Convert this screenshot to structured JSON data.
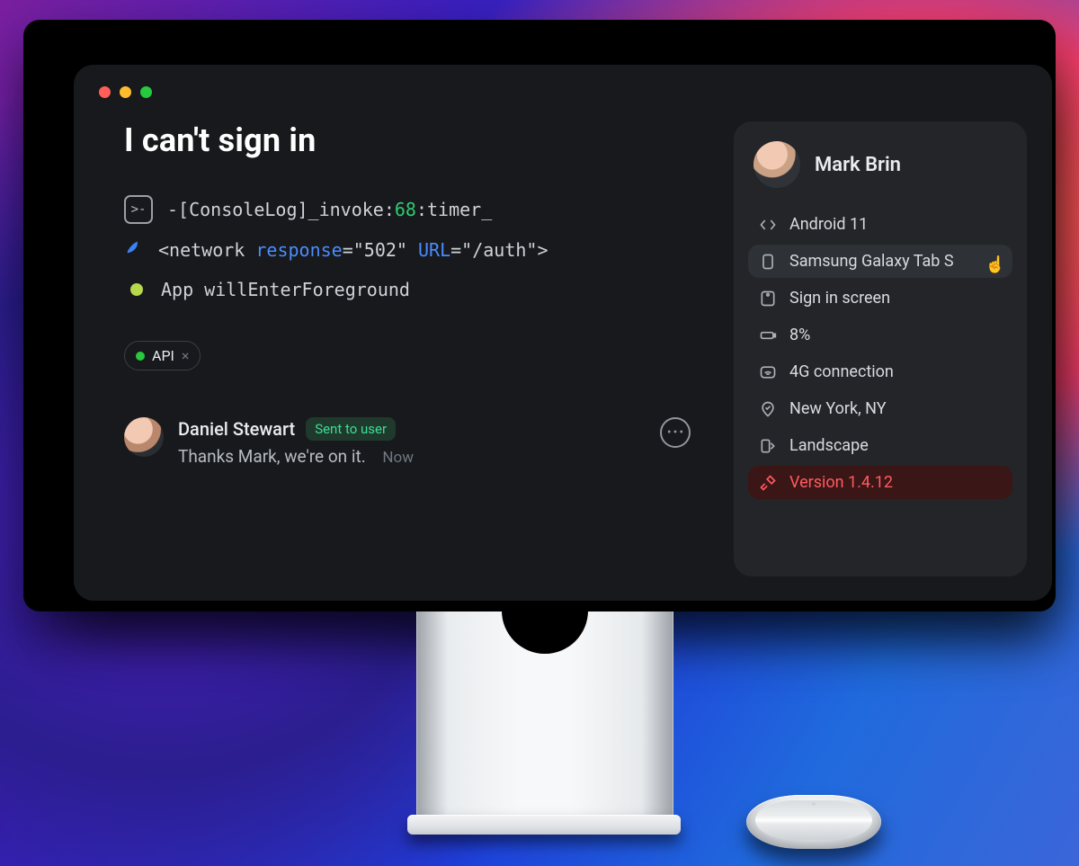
{
  "ticket": {
    "title": "I can't sign in"
  },
  "log": {
    "console": {
      "prefix": "-[ConsoleLog]_invoke:",
      "num": "68",
      "suffix": ":timer_"
    },
    "network": {
      "open": "<network ",
      "respKey": "response",
      "respVal": "=\"502\" ",
      "urlKey": "URL",
      "urlVal": "=\"/auth\">"
    },
    "app_event": "App willEnterForeground"
  },
  "tag": {
    "label": "API"
  },
  "reply": {
    "author": "Daniel Stewart",
    "badge": "Sent to user",
    "message": "Thanks Mark, we're on it.",
    "time": "Now"
  },
  "user": {
    "name": "Mark Brin"
  },
  "device": {
    "os": "Android 11",
    "model": "Samsung Galaxy Tab S",
    "screen": "Sign in screen",
    "battery": "8%",
    "network": "4G connection",
    "location": "New York, NY",
    "orientation": "Landscape",
    "version": "Version 1.4.12"
  }
}
